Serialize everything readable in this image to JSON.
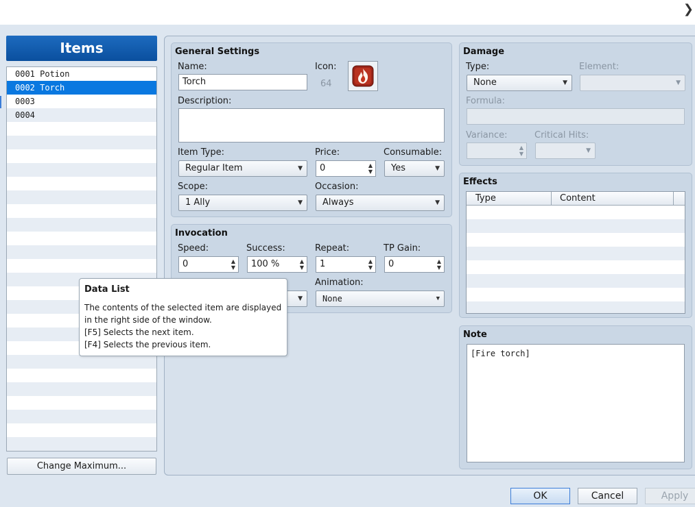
{
  "items_panel": {
    "title": "Items",
    "rows": [
      "0001 Potion",
      "0002 Torch",
      "0003",
      "0004"
    ],
    "selected_index": 1,
    "change_max_label": "Change Maximum..."
  },
  "general": {
    "title": "General Settings",
    "name_label": "Name:",
    "name_value": "Torch",
    "icon_label": "Icon:",
    "icon_index": "64",
    "icon_name": "fire-icon",
    "description_label": "Description:",
    "description_value": "",
    "item_type_label": "Item Type:",
    "item_type_value": "Regular Item",
    "price_label": "Price:",
    "price_value": "0",
    "consumable_label": "Consumable:",
    "consumable_value": "Yes",
    "scope_label": "Scope:",
    "scope_value": "1 Ally",
    "occasion_label": "Occasion:",
    "occasion_value": "Always"
  },
  "invocation": {
    "title": "Invocation",
    "speed_label": "Speed:",
    "speed_value": "0",
    "success_label": "Success:",
    "success_value": "100 %",
    "repeat_label": "Repeat:",
    "repeat_value": "1",
    "tp_gain_label": "TP Gain:",
    "tp_gain_value": "0",
    "animation_label": "Animation:",
    "animation_value": "None"
  },
  "damage": {
    "title": "Damage",
    "type_label": "Type:",
    "type_value": "None",
    "element_label": "Element:",
    "element_value": "",
    "formula_label": "Formula:",
    "formula_value": "",
    "variance_label": "Variance:",
    "variance_value": "",
    "critical_label": "Critical Hits:",
    "critical_value": ""
  },
  "effects": {
    "title": "Effects",
    "columns": [
      "Type",
      "Content"
    ]
  },
  "note": {
    "title": "Note",
    "value": "[Fire torch]"
  },
  "tooltip": {
    "title": "Data List",
    "lines": [
      "The contents of the selected item are displayed",
      "in the right side of the window.",
      "[F5] Selects the next item.",
      "[F4] Selects the previous item."
    ]
  },
  "buttons": {
    "ok": "OK",
    "cancel": "Cancel",
    "apply": "Apply"
  },
  "colors": {
    "selection": "#0a78e0",
    "header": "#0a4f9e",
    "panel": "#cad7e5"
  }
}
